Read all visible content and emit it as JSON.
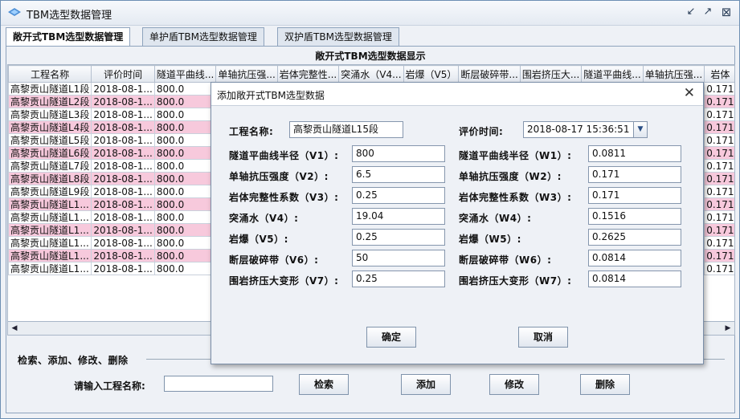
{
  "window": {
    "title": "TBM选型数据管理"
  },
  "tabs": [
    {
      "label": "敞开式TBM选型数据管理"
    },
    {
      "label": "单护盾TBM选型数据管理"
    },
    {
      "label": "双护盾TBM选型数据管理"
    }
  ],
  "table": {
    "title": "敞开式TBM选型数据显示",
    "columns": [
      "工程名称",
      "评价时间",
      "隧道平曲线...",
      "单轴抗压强...",
      "岩体完整性...",
      "突涌水（V4...",
      "岩爆（V5）",
      "断层破碎带...",
      "围岩挤压大...",
      "隧道平曲线...",
      "单轴抗压强...",
      "岩体"
    ],
    "rows": [
      [
        "高黎贡山隧道L1段",
        "2018-08-1...",
        "800.0",
        "",
        "",
        "",
        "",
        "",
        "",
        "",
        "",
        "0.171"
      ],
      [
        "高黎贡山隧道L2段",
        "2018-08-1...",
        "800.0",
        "",
        "",
        "",
        "",
        "",
        "",
        "",
        "",
        "0.171"
      ],
      [
        "高黎贡山隧道L3段",
        "2018-08-1...",
        "800.0",
        "",
        "",
        "",
        "",
        "",
        "",
        "",
        "",
        "0.171"
      ],
      [
        "高黎贡山隧道L4段",
        "2018-08-1...",
        "800.0",
        "",
        "",
        "",
        "",
        "",
        "",
        "",
        "",
        "0.171"
      ],
      [
        "高黎贡山隧道L5段",
        "2018-08-1...",
        "800.0",
        "",
        "",
        "",
        "",
        "",
        "",
        "",
        "",
        "0.171"
      ],
      [
        "高黎贡山隧道L6段",
        "2018-08-1...",
        "800.0",
        "",
        "",
        "",
        "",
        "",
        "",
        "",
        "",
        "0.171"
      ],
      [
        "高黎贡山隧道L7段",
        "2018-08-1...",
        "800.0",
        "",
        "",
        "",
        "",
        "",
        "",
        "",
        "",
        "0.171"
      ],
      [
        "高黎贡山隧道L8段",
        "2018-08-1...",
        "800.0",
        "",
        "",
        "",
        "",
        "",
        "",
        "",
        "",
        "0.171"
      ],
      [
        "高黎贡山隧道L9段",
        "2018-08-1...",
        "800.0",
        "",
        "",
        "",
        "",
        "",
        "",
        "",
        "",
        "0.171"
      ],
      [
        "高黎贡山隧道L1...",
        "2018-08-1...",
        "800.0",
        "",
        "",
        "",
        "",
        "",
        "",
        "",
        "",
        "0.171"
      ],
      [
        "高黎贡山隧道L1...",
        "2018-08-1...",
        "800.0",
        "",
        "",
        "",
        "",
        "",
        "",
        "",
        "",
        "0.171"
      ],
      [
        "高黎贡山隧道L1...",
        "2018-08-1...",
        "800.0",
        "",
        "",
        "",
        "",
        "",
        "",
        "",
        "",
        "0.171"
      ],
      [
        "高黎贡山隧道L1...",
        "2018-08-1...",
        "800.0",
        "",
        "",
        "",
        "",
        "",
        "",
        "",
        "",
        "0.171"
      ],
      [
        "高黎贡山隧道L1...",
        "2018-08-1...",
        "800.0",
        "",
        "",
        "",
        "",
        "",
        "",
        "",
        "",
        "0.171"
      ],
      [
        "高黎贡山隧道L1...",
        "2018-08-1...",
        "800.0",
        "",
        "",
        "",
        "",
        "",
        "",
        "",
        "",
        "0.171"
      ]
    ],
    "row_highlight_color": "#f7c9dc"
  },
  "search": {
    "legend": "检索、添加、修改、删除",
    "label": "请输入工程名称:",
    "input_value": "",
    "buttons": {
      "search": "检索",
      "add": "添加",
      "edit": "修改",
      "delete": "删除"
    }
  },
  "dialog": {
    "title": "添加敞开式TBM选型数据",
    "close_icon": "close-icon",
    "project_label": "工程名称:",
    "project_value": "高黎贡山隧道L15段",
    "time_label": "评价时间:",
    "time_value": "2018-08-17 15:36:51",
    "left_fields": [
      {
        "label": "隧道平曲线半径（V1）:",
        "value": "800"
      },
      {
        "label": "单轴抗压强度（V2）:",
        "value": "6.5"
      },
      {
        "label": "岩体完整性系数（V3）:",
        "value": "0.25"
      },
      {
        "label": "突涌水（V4）:",
        "value": "19.04"
      },
      {
        "label": "岩爆（V5）:",
        "value": "0.25"
      },
      {
        "label": "断层破碎带（V6）:",
        "value": "50"
      },
      {
        "label": "围岩挤压大变形（V7）:",
        "value": "0.25"
      }
    ],
    "right_fields": [
      {
        "label": "隧道平曲线半径（W1）:",
        "value": "0.0811"
      },
      {
        "label": "单轴抗压强度（W2）:",
        "value": "0.171"
      },
      {
        "label": "岩体完整性系数（W3）:",
        "value": "0.171"
      },
      {
        "label": "突涌水（W4）:",
        "value": "0.1516"
      },
      {
        "label": "岩爆（W5）:",
        "value": "0.2625"
      },
      {
        "label": "断层破碎带（W6）:",
        "value": "0.0814"
      },
      {
        "label": "围岩挤压大变形（W7）:",
        "value": "0.0814"
      }
    ],
    "ok_label": "确定",
    "cancel_label": "取消"
  }
}
